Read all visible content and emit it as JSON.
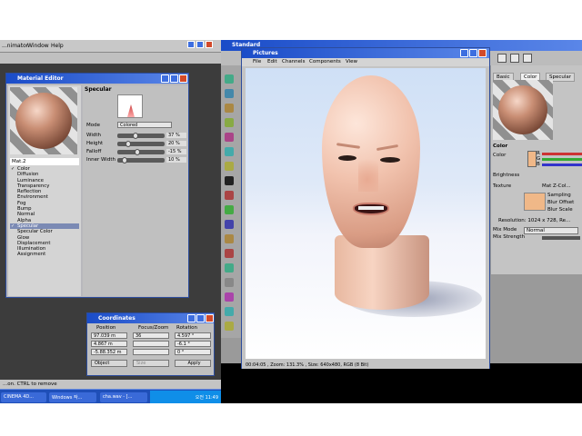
{
  "left_app": {
    "menu": [
      "...nimator",
      "Window",
      "Help"
    ],
    "status_text": "...on. CTRL to remove"
  },
  "material_editor": {
    "title": "Material Editor",
    "material_name": "Mat.2",
    "channels": [
      {
        "label": "Color",
        "checked": true
      },
      {
        "label": "Diffusion",
        "checked": false
      },
      {
        "label": "Luminance",
        "checked": false
      },
      {
        "label": "Transparency",
        "checked": false
      },
      {
        "label": "Reflection",
        "checked": false
      },
      {
        "label": "Environment",
        "checked": false
      },
      {
        "label": "Fog",
        "checked": false
      },
      {
        "label": "Bump",
        "checked": false
      },
      {
        "label": "Normal",
        "checked": false
      },
      {
        "label": "Alpha",
        "checked": false
      },
      {
        "label": "Specular",
        "checked": true,
        "active": true
      },
      {
        "label": "Specular Color",
        "checked": false
      },
      {
        "label": "Glow",
        "checked": false
      },
      {
        "label": "Displacement",
        "checked": false
      },
      {
        "label": "Illumination",
        "checked": false
      },
      {
        "label": "Assignment",
        "checked": false
      }
    ],
    "panel_header": "Specular",
    "mode_label": "Mode",
    "mode_value": "Colored",
    "params": [
      {
        "label": "Width",
        "value": "37 %",
        "fraction": 0.37
      },
      {
        "label": "Height",
        "value": "20 %",
        "fraction": 0.2
      },
      {
        "label": "Falloff",
        "value": "-15 %",
        "fraction": 0.42
      },
      {
        "label": "Inner Width",
        "value": "10 %",
        "fraction": 0.1
      }
    ]
  },
  "coordinates": {
    "title": "Coordinates",
    "col_position": "Position",
    "col_size": "Focus/Zoom",
    "col_rotation": "Rotation",
    "pos": [
      "97.039 m",
      "4.867 m",
      "-5.88.352 m"
    ],
    "size": [
      "36",
      "",
      ""
    ],
    "rot": [
      "4.597 °",
      "-6.1 °",
      "0 °"
    ],
    "object_btn": "Object",
    "size_btn": "Size",
    "apply_btn": "Apply"
  },
  "taskbar": {
    "items": [
      "CINEMA 4D...",
      "Windows 작...",
      "cha.wav - [..."
    ],
    "time": "오전 11:49"
  },
  "right_app": {
    "title": "Standard"
  },
  "picture_viewer": {
    "title": "Pictures",
    "menu": [
      "File",
      "Edit",
      "Channels",
      "Components",
      "View"
    ],
    "status": "00:04:05 , Zoom: 131.3% , Size: 640x480, RGB (8 Bit)"
  },
  "attr_panel": {
    "tabs": [
      "Basic",
      "Color",
      "Specular"
    ],
    "section": "Color",
    "color_label": "Color",
    "rgb": [
      "R",
      "G",
      "B"
    ],
    "brightness_label": "Brightness",
    "texture_label": "Texture",
    "texture_value": "Mat Z-Col...",
    "sampling_label": "Sampling",
    "blur_offset_label": "Blur Offset",
    "blur_scale_label": "Blur Scale",
    "resolution": "Resolution: 1024 x 728, Re...",
    "mix_mode_label": "Mix Mode",
    "mix_mode_value": "Normal",
    "mix_strength_label": "Mix Strength",
    "swatch_color": "#f0b888"
  }
}
